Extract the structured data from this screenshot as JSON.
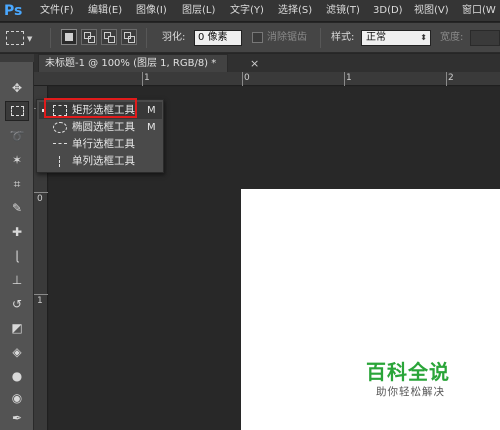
{
  "app": {
    "logo": "Ps"
  },
  "menu": [
    "文件(F)",
    "编辑(E)",
    "图像(I)",
    "图层(L)",
    "文字(Y)",
    "选择(S)",
    "滤镜(T)",
    "3D(D)",
    "视图(V)",
    "窗口(W"
  ],
  "options": {
    "feather_label": "羽化:",
    "feather_value": "0 像素",
    "antialias_label": "消除锯齿",
    "style_label": "样式:",
    "style_value": "正常",
    "width_label": "宽度:"
  },
  "document": {
    "tab_title": "未标题-1 @ 100% (图层 1, RGB/8) *",
    "close_glyph": "×"
  },
  "rulers": {
    "top": [
      "1",
      "0",
      "1",
      "2"
    ],
    "left": [
      "1",
      "0",
      "1"
    ]
  },
  "flyout": {
    "items": [
      {
        "label": "矩形选框工具",
        "shortcut": "M"
      },
      {
        "label": "椭圆选框工具",
        "shortcut": "M"
      },
      {
        "label": "单行选框工具",
        "shortcut": ""
      },
      {
        "label": "单列选框工具",
        "shortcut": ""
      }
    ]
  },
  "watermark": {
    "title": "百科全说",
    "subtitle": "助你轻松解决"
  },
  "colors": {
    "highlight": "#e01b1b",
    "watermark": "#2aa539",
    "ps_blue": "#4aa8ff"
  },
  "tools": [
    "move-tool",
    "marquee-tool",
    "lasso-tool",
    "magic-wand-tool",
    "crop-tool",
    "eyedropper-tool",
    "healing-tool",
    "brush-tool",
    "clone-stamp-tool",
    "history-brush-tool",
    "eraser-tool",
    "paint-bucket-tool",
    "blur-tool",
    "dodge-tool",
    "pen-tool",
    "type-tool"
  ]
}
